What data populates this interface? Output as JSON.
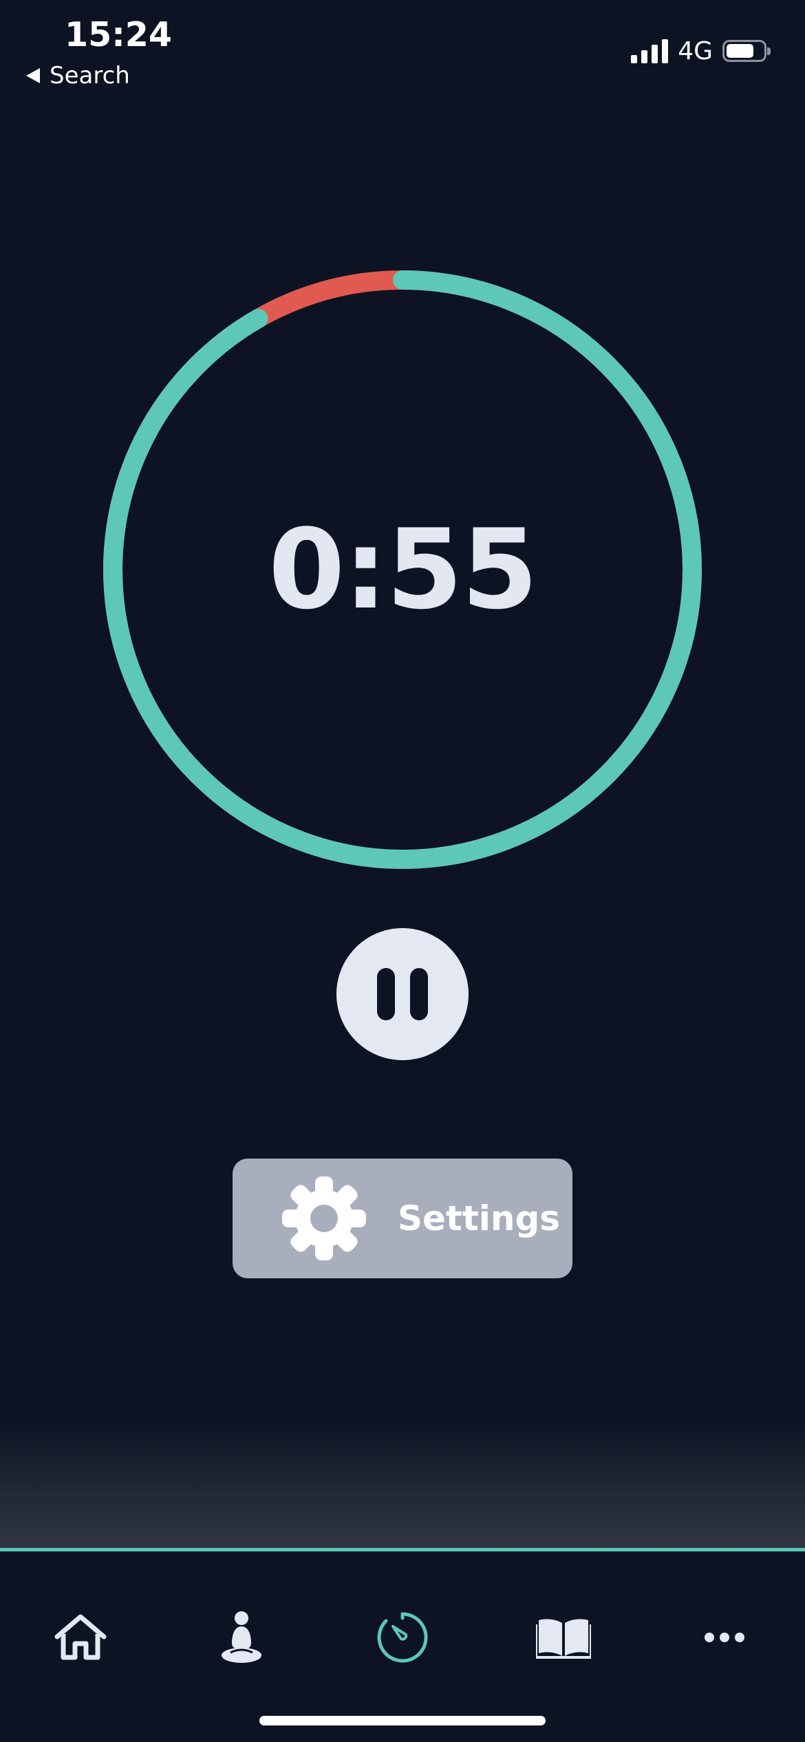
{
  "status_bar": {
    "time": "15:24",
    "back_label": "Search",
    "network": "4G",
    "battery_level": 0.75,
    "signal_bars": 4
  },
  "timer": {
    "display": "0:55",
    "remaining_fraction": 0.917,
    "track_color": "#5dc8b6",
    "elapsed_color": "#e05a4f"
  },
  "controls": {
    "pause_icon": "pause-icon",
    "settings_label": "Settings",
    "settings_icon": "gear-icon"
  },
  "tab_bar": {
    "items": [
      {
        "name": "home",
        "icon": "home-icon",
        "active": false
      },
      {
        "name": "meditate",
        "icon": "meditation-person-icon",
        "active": false
      },
      {
        "name": "timer",
        "icon": "timer-icon",
        "active": true
      },
      {
        "name": "library",
        "icon": "book-icon",
        "active": false
      },
      {
        "name": "more",
        "icon": "more-dots-icon",
        "active": false
      }
    ],
    "active_color": "#5dc8b6",
    "inactive_color": "#e3e8f3"
  }
}
